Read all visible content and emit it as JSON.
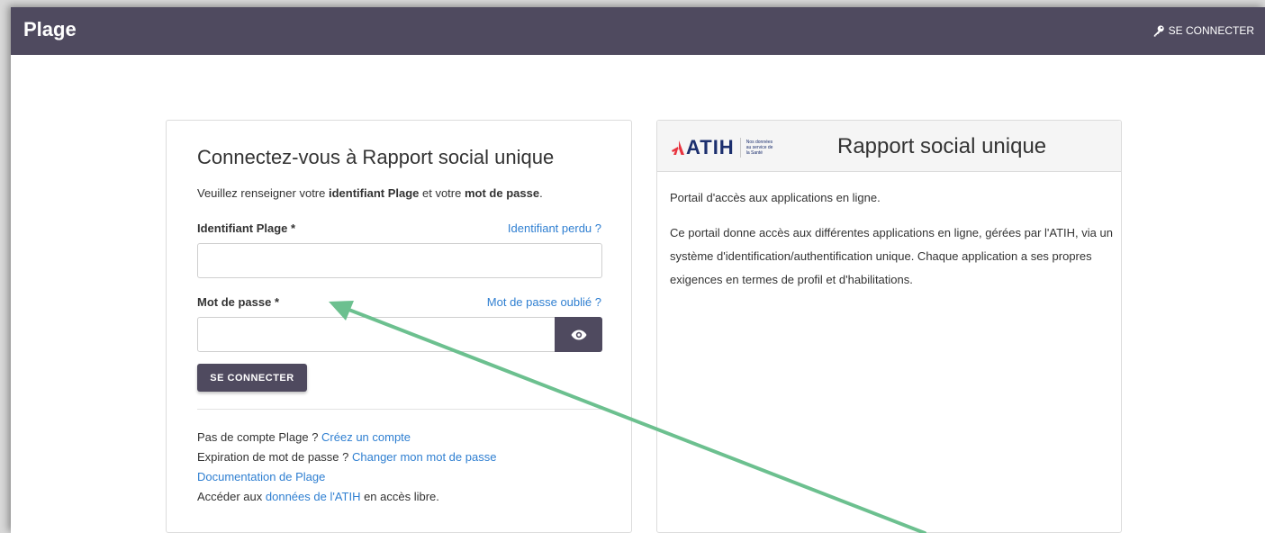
{
  "header": {
    "brand": "Plage",
    "login_label": "SE CONNECTER",
    "bg_color": "#4f4a5f"
  },
  "login": {
    "title": "Connectez-vous à Rapport social unique",
    "intro_prefix": "Veuillez renseigner votre ",
    "intro_bold1": "identifiant Plage",
    "intro_mid": " et votre ",
    "intro_bold2": "mot de passe",
    "intro_suffix": ".",
    "identifier_label": "Identifiant Plage *",
    "identifier_lost_link": "Identifiant perdu ?",
    "identifier_value": "",
    "password_label": "Mot de passe *",
    "password_lost_link": "Mot de passe oublié ?",
    "password_value": "",
    "submit_label": "SE CONNECTER",
    "footer": {
      "no_account_text": "Pas de compte Plage ? ",
      "create_account_link": "Créez un compte",
      "expiration_text": "Expiration de mot de passe ? ",
      "change_password_link": "Changer mon mot de passe",
      "documentation_link": "Documentation de Plage",
      "access_prefix": "Accéder aux ",
      "data_link": "données de l'ATIH",
      "access_suffix": " en accès libre."
    }
  },
  "info": {
    "logo_text": "ATIH",
    "logo_tagline": "Nos données au service de la Santé",
    "title": "Rapport social unique",
    "paragraph1": "Portail d'accès aux applications en ligne.",
    "paragraph2": "Ce portail donne accès aux différentes applications en ligne, gérées par l'ATIH, via un système d'identification/authentification unique. Chaque application a ses propres exigences en termes de profil et d'habilitations."
  },
  "annotation": {
    "arrow_color": "#6cc08f"
  },
  "icons": {
    "top_login": "key-icon",
    "password_toggle": "eye-icon"
  },
  "colors": {
    "link": "#2f7fd1",
    "logo_red": "#e8343f",
    "logo_navy": "#1c2f6e"
  }
}
